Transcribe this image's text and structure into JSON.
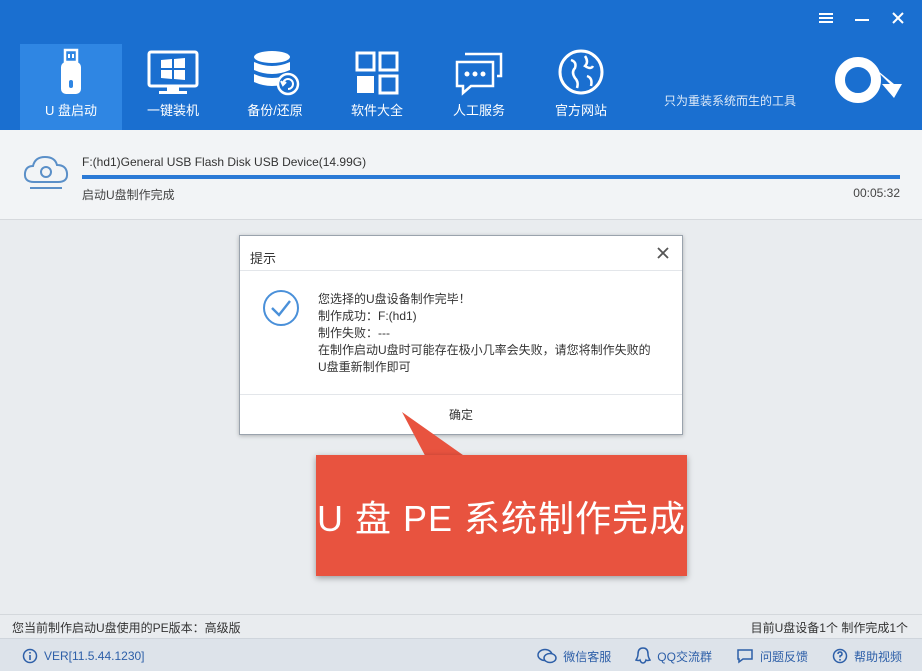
{
  "window": {
    "controls": [
      {
        "name": "menu-icon"
      },
      {
        "name": "minimize-icon"
      },
      {
        "name": "close-icon"
      }
    ]
  },
  "nav": {
    "items": [
      {
        "label": "U 盘启动",
        "icon": "usb-drive-icon",
        "active": true
      },
      {
        "label": "一键装机",
        "icon": "monitor-windows-icon",
        "active": false
      },
      {
        "label": "备份/还原",
        "icon": "database-restore-icon",
        "active": false
      },
      {
        "label": "软件大全",
        "icon": "app-grid-icon",
        "active": false
      },
      {
        "label": "人工服务",
        "icon": "chat-bubbles-icon",
        "active": false
      },
      {
        "label": "官方网站",
        "icon": "globe-icon",
        "active": false
      }
    ],
    "brand_text": "只为重装系统而生的工具",
    "colors": {
      "header": "#1a6fd0",
      "active": "#2f86e3"
    }
  },
  "progress": {
    "device": "F:(hd1)General USB Flash Disk USB Device(14.99G)",
    "status": "启动U盘制作完成",
    "elapsed": "00:05:32",
    "percent": 100,
    "bar_color": "#2b7ad6"
  },
  "dialog": {
    "title": "提示",
    "lines": [
      "您选择的U盘设备制作完毕！",
      "制作成功：F:(hd1)",
      "制作失败：---",
      "在制作启动U盘时可能存在极小几率会失败，请您将制作失败的",
      "U盘重新制作即可"
    ],
    "ok_label": "确定"
  },
  "callout": {
    "text": "U 盘 PE 系统制作完成",
    "color": "#e8533f"
  },
  "status_bar": {
    "pe_version": "您当前制作启动U盘使用的PE版本：高级版",
    "device_count": "目前U盘设备1个 制作完成1个"
  },
  "footer": {
    "version": "VER[11.5.44.1230]",
    "links": [
      {
        "label": "微信客服",
        "icon": "wechat-icon"
      },
      {
        "label": "QQ交流群",
        "icon": "qq-icon"
      },
      {
        "label": "问题反馈",
        "icon": "feedback-icon"
      },
      {
        "label": "帮助视频",
        "icon": "help-icon"
      }
    ]
  }
}
